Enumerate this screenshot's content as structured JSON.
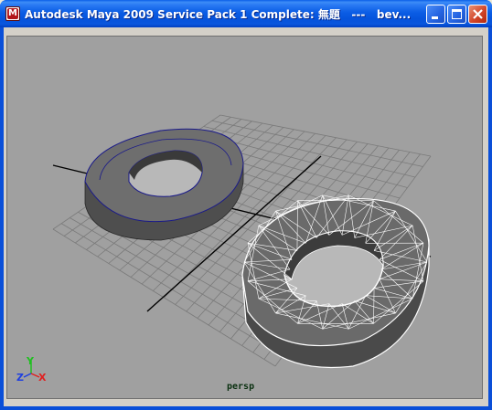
{
  "window": {
    "title": "Autodesk Maya 2009 Service Pack 1 Complete: 無題   ---   bev..."
  },
  "viewport": {
    "camera_label": "persp",
    "axis_labels": {
      "x": "X",
      "y": "Y",
      "z": "Z"
    },
    "colors": {
      "background": "#a0a0a0",
      "grid": "#7a7a7a",
      "axis_line": "#000000",
      "mesh_shaded": "#6e6e6e",
      "wire_selected": "#ffffff",
      "border_highlight": "#1a1a8a",
      "axis_x": "#e02020",
      "axis_y": "#20c020",
      "axis_z": "#2040e0"
    }
  },
  "icons": {
    "app": "maya-icon",
    "minimize": "minimize-icon",
    "maximize": "maximize-icon",
    "close": "close-icon"
  }
}
